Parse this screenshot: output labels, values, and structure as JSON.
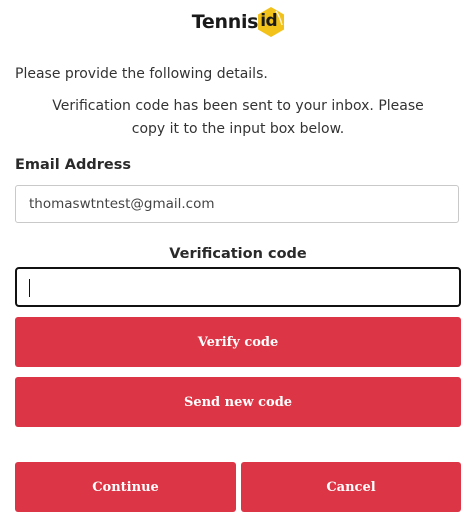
{
  "brand": {
    "name": "Tennis",
    "badge_text": "id",
    "badge_color": "#f2c21a"
  },
  "intro_text": "Please provide the following details.",
  "instructions": {
    "line1": "Verification code has been sent to your inbox. Please",
    "line2": "copy it to the input box below."
  },
  "email": {
    "label": "Email Address",
    "value": "thomaswtntest@gmail.com"
  },
  "verification": {
    "label": "Verification code",
    "value": "",
    "placeholder": ""
  },
  "buttons": {
    "verify": "Verify code",
    "send_new": "Send new code",
    "continue": "Continue",
    "cancel": "Cancel"
  },
  "colors": {
    "accent": "#dc3545",
    "focus_border": "#111111"
  }
}
